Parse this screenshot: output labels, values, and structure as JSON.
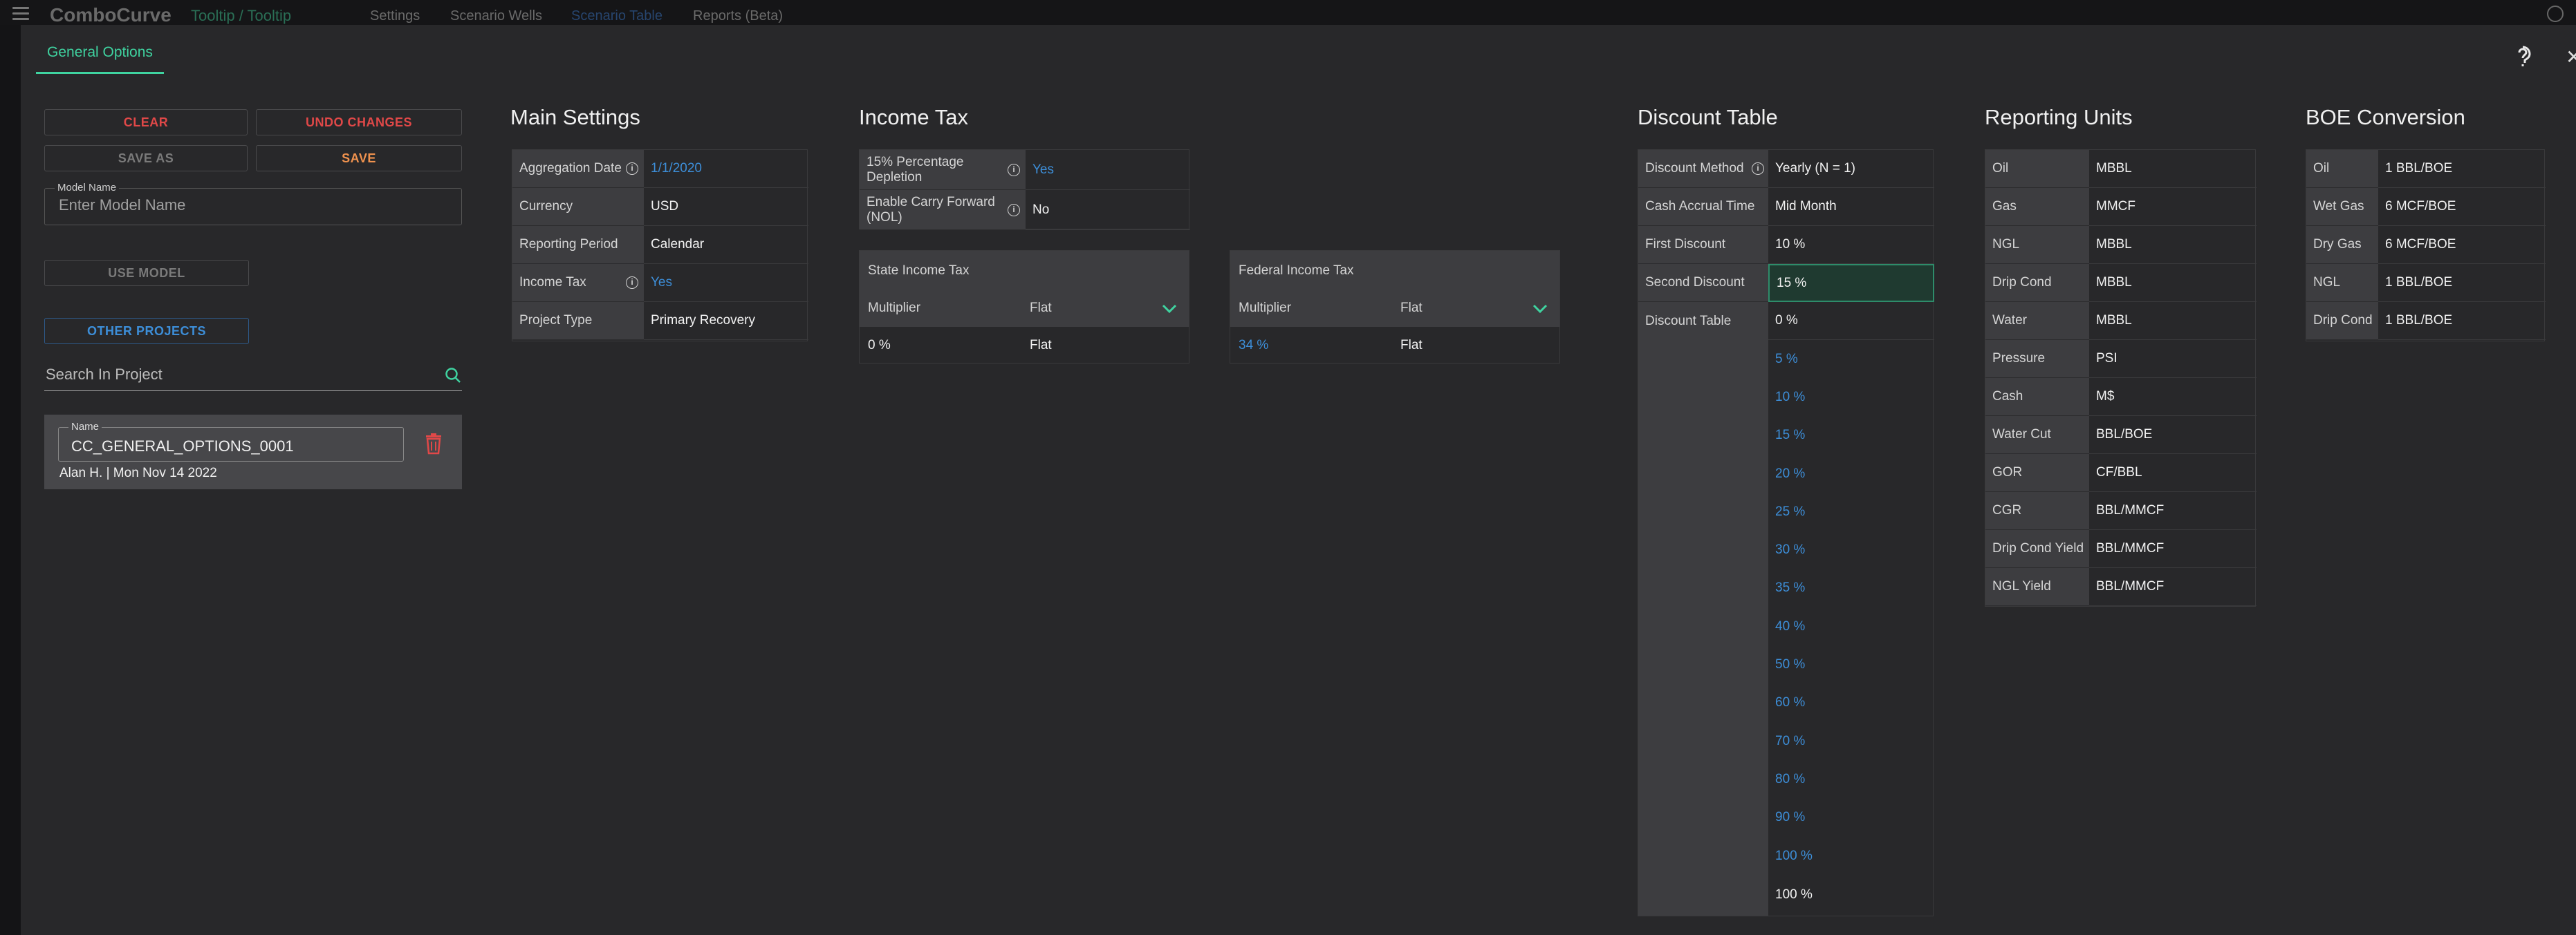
{
  "appbar": {
    "logo": "ComboCurve",
    "breadcrumb": "Tooltip / Tooltip",
    "nav": [
      "Settings",
      "Scenario Wells",
      "Scenario Table",
      "Reports (Beta)"
    ]
  },
  "dialog": {
    "tab_label": "General Options"
  },
  "left_panel": {
    "clear_label": "CLEAR",
    "undo_label": "UNDO CHANGES",
    "save_as_label": "SAVE AS",
    "save_label": "SAVE",
    "model_name_label": "Model Name",
    "model_name_placeholder": "Enter Model Name",
    "use_model_label": "USE MODEL",
    "other_projects_label": "OTHER PROJECTS",
    "search_placeholder": "Search In Project",
    "model_card": {
      "name_label": "Name",
      "name_value": "CC_GENERAL_OPTIONS_0001",
      "meta": "Alan H. | Mon Nov 14 2022"
    }
  },
  "main_settings": {
    "title": "Main Settings",
    "rows": [
      {
        "key": "Aggregation Date",
        "value": "1/1/2020"
      },
      {
        "key": "Currency",
        "value": "USD"
      },
      {
        "key": "Reporting Period",
        "value": "Calendar"
      },
      {
        "key": "Income Tax",
        "value": "Yes"
      },
      {
        "key": "Project Type",
        "value": "Primary Recovery"
      }
    ]
  },
  "income_tax": {
    "title": "Income Tax",
    "rows": [
      {
        "key": "15% Percentage Depletion",
        "value": "Yes"
      },
      {
        "key": "Enable Carry Forward (NOL)",
        "value": "No"
      }
    ],
    "state": {
      "title": "State Income Tax",
      "col1": "Multiplier",
      "col2": "Flat",
      "value": "0 %",
      "value_type": "Flat"
    },
    "federal": {
      "title": "Federal Income Tax",
      "col1": "Multiplier",
      "col2": "Flat",
      "value": "34 %",
      "value_type": "Flat"
    }
  },
  "discount_table": {
    "title": "Discount Table",
    "rows": [
      {
        "key": "Discount Method",
        "value": "Yearly (N = 1)"
      },
      {
        "key": "Cash Accrual Time",
        "value": "Mid Month"
      },
      {
        "key": "First Discount",
        "value": "10 %"
      },
      {
        "key": "Second Discount",
        "value": "15 %"
      },
      {
        "key": "Discount Table",
        "value": "0 %"
      }
    ],
    "table_values": [
      "5 %",
      "10 %",
      "15 %",
      "20 %",
      "25 %",
      "30 %",
      "35 %",
      "40 %",
      "50 %",
      "60 %",
      "70 %",
      "80 %",
      "90 %",
      "100 %"
    ],
    "last_value": "100 %"
  },
  "reporting_units": {
    "title": "Reporting Units",
    "rows": [
      {
        "key": "Oil",
        "value": "MBBL"
      },
      {
        "key": "Gas",
        "value": "MMCF"
      },
      {
        "key": "NGL",
        "value": "MBBL"
      },
      {
        "key": "Drip Cond",
        "value": "MBBL"
      },
      {
        "key": "Water",
        "value": "MBBL"
      },
      {
        "key": "Pressure",
        "value": "PSI"
      },
      {
        "key": "Cash",
        "value": "M$"
      },
      {
        "key": "Water Cut",
        "value": "BBL/BOE"
      },
      {
        "key": "GOR",
        "value": "CF/BBL"
      },
      {
        "key": "CGR",
        "value": "BBL/MMCF"
      },
      {
        "key": "Drip Cond Yield",
        "value": "BBL/MMCF"
      },
      {
        "key": "NGL Yield",
        "value": "BBL/MMCF"
      }
    ]
  },
  "boe_conversion": {
    "title": "BOE Conversion",
    "rows": [
      {
        "key": "Oil",
        "value": "1 BBL/BOE"
      },
      {
        "key": "Wet Gas",
        "value": "6 MCF/BOE"
      },
      {
        "key": "Dry Gas",
        "value": "6 MCF/BOE"
      },
      {
        "key": "NGL",
        "value": "1 BBL/BOE"
      },
      {
        "key": "Drip Cond",
        "value": "1 BBL/BOE"
      }
    ]
  },
  "colors": {
    "accent": "#3fd3a0",
    "link": "#3d8ed8",
    "danger": "#e04848",
    "warning": "#f0924e"
  }
}
